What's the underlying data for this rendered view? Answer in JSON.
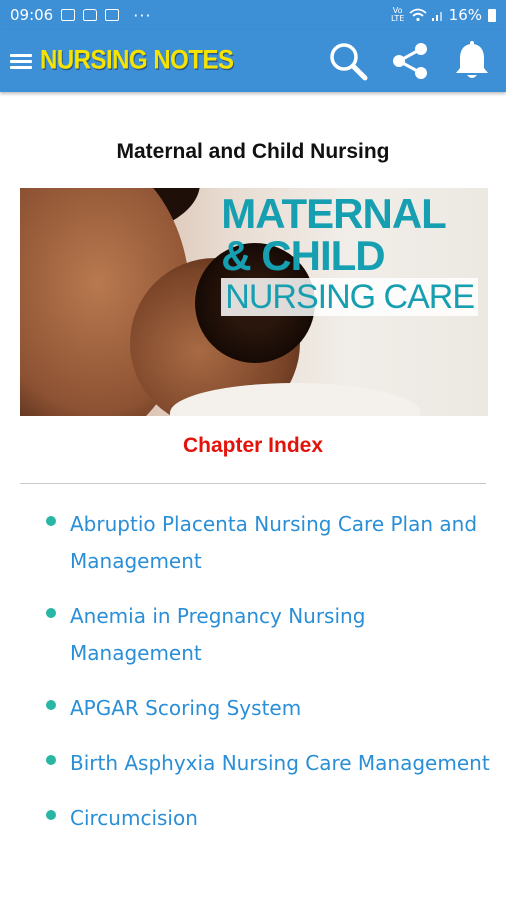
{
  "status_bar": {
    "time": "09:06",
    "overflow": "···",
    "network": "VoLTE",
    "battery": "16%"
  },
  "app_bar": {
    "title": "NURSING NOTES",
    "title_color": "#f6e400",
    "background": "#3d8fd6",
    "actions": [
      "search-icon",
      "share-icon",
      "notification-bell-icon"
    ]
  },
  "content": {
    "book_title": "Maternal and Child Nursing",
    "hero_image": {
      "line1": "MATERNAL",
      "line2": "& CHILD",
      "line3": "NURSING CARE"
    },
    "chapter_index_label": "Chapter Index",
    "accent_color": "#e3120b",
    "link_color": "#2a8fd6",
    "bullet_color": "#29b6a4",
    "chapters": [
      {
        "label": "Abruptio Placenta Nursing Care Plan and Management"
      },
      {
        "label": "Anemia in Pregnancy Nursing Management"
      },
      {
        "label": "APGAR Scoring System"
      },
      {
        "label": "Birth Asphyxia Nursing Care Management"
      },
      {
        "label": "Circumcision"
      }
    ]
  }
}
